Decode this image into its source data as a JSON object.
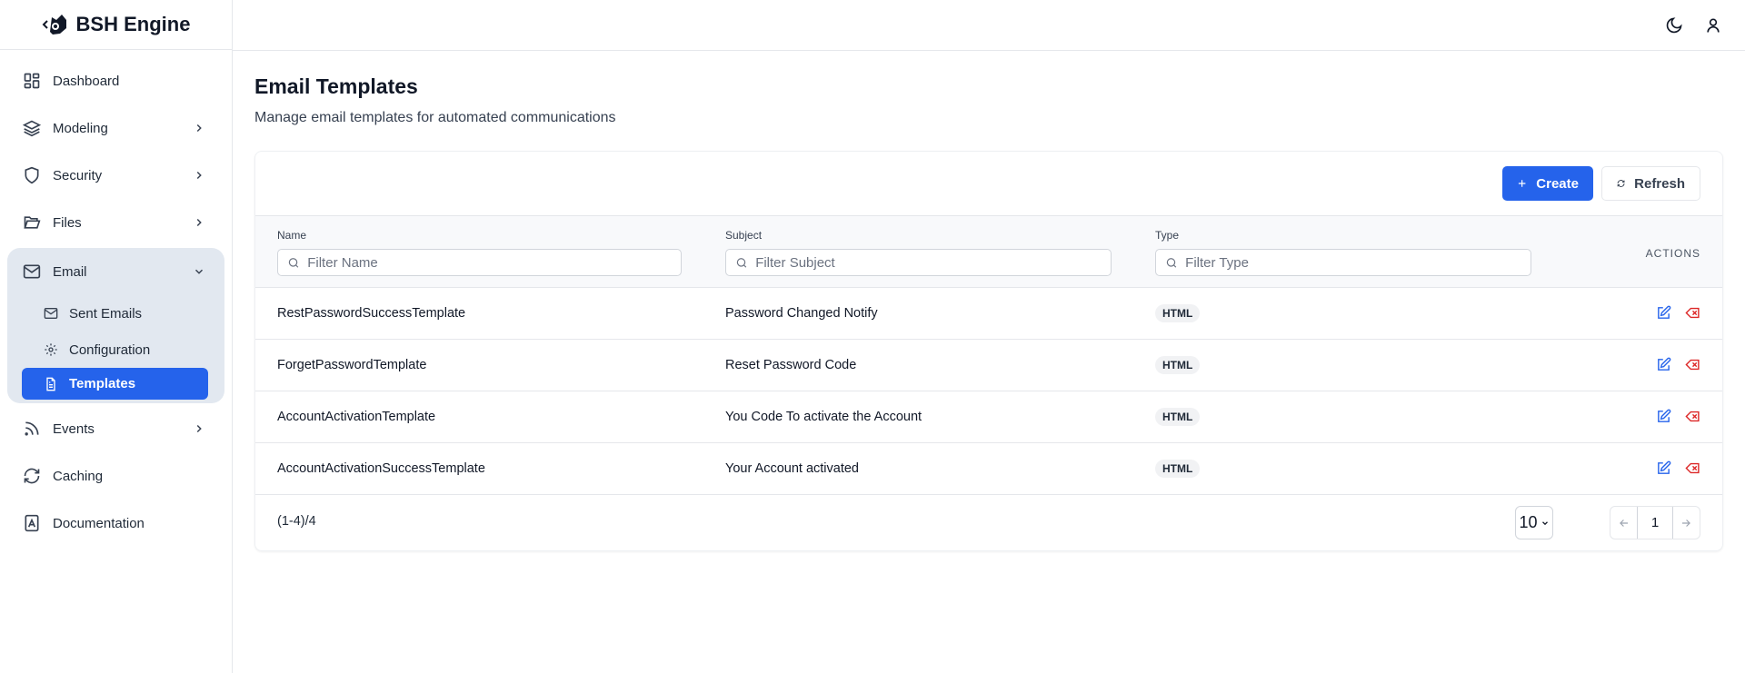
{
  "app": {
    "name": "BSH Engine"
  },
  "sidebar": {
    "items": [
      {
        "label": "Dashboard",
        "icon": "dashboard-icon"
      },
      {
        "label": "Modeling",
        "icon": "layers-icon"
      },
      {
        "label": "Security",
        "icon": "shield-icon"
      },
      {
        "label": "Files",
        "icon": "folder-icon"
      },
      {
        "label": "Email",
        "icon": "mail-icon"
      },
      {
        "label": "Events",
        "icon": "rss-icon"
      },
      {
        "label": "Caching",
        "icon": "refresh-icon"
      },
      {
        "label": "Documentation",
        "icon": "book-icon"
      }
    ],
    "email_sub": [
      {
        "label": "Sent Emails"
      },
      {
        "label": "Configuration"
      },
      {
        "label": "Templates",
        "active": true
      }
    ]
  },
  "page": {
    "title": "Email Templates",
    "description": "Manage email templates for automated communications"
  },
  "toolbar": {
    "create": "Create",
    "refresh": "Refresh"
  },
  "table": {
    "columns": [
      {
        "label": "Name",
        "placeholder": "Filter Name"
      },
      {
        "label": "Subject",
        "placeholder": "Filter Subject"
      },
      {
        "label": "Type",
        "placeholder": "Filter Type"
      }
    ],
    "actions_label": "ACTIONS",
    "rows": [
      {
        "name": "RestPasswordSuccessTemplate",
        "subject": "Password Changed Notify",
        "type": "HTML"
      },
      {
        "name": "ForgetPasswordTemplate",
        "subject": "Reset Password Code",
        "type": "HTML"
      },
      {
        "name": "AccountActivationTemplate",
        "subject": "You Code To activate the Account",
        "type": "HTML"
      },
      {
        "name": "AccountActivationSuccessTemplate",
        "subject": "Your Account activated",
        "type": "HTML"
      }
    ]
  },
  "pagination": {
    "summary": "(1-4)/4",
    "page_size": "10",
    "current_page": "1"
  },
  "colors": {
    "accent": "#2563eb",
    "danger": "#dc2626"
  }
}
